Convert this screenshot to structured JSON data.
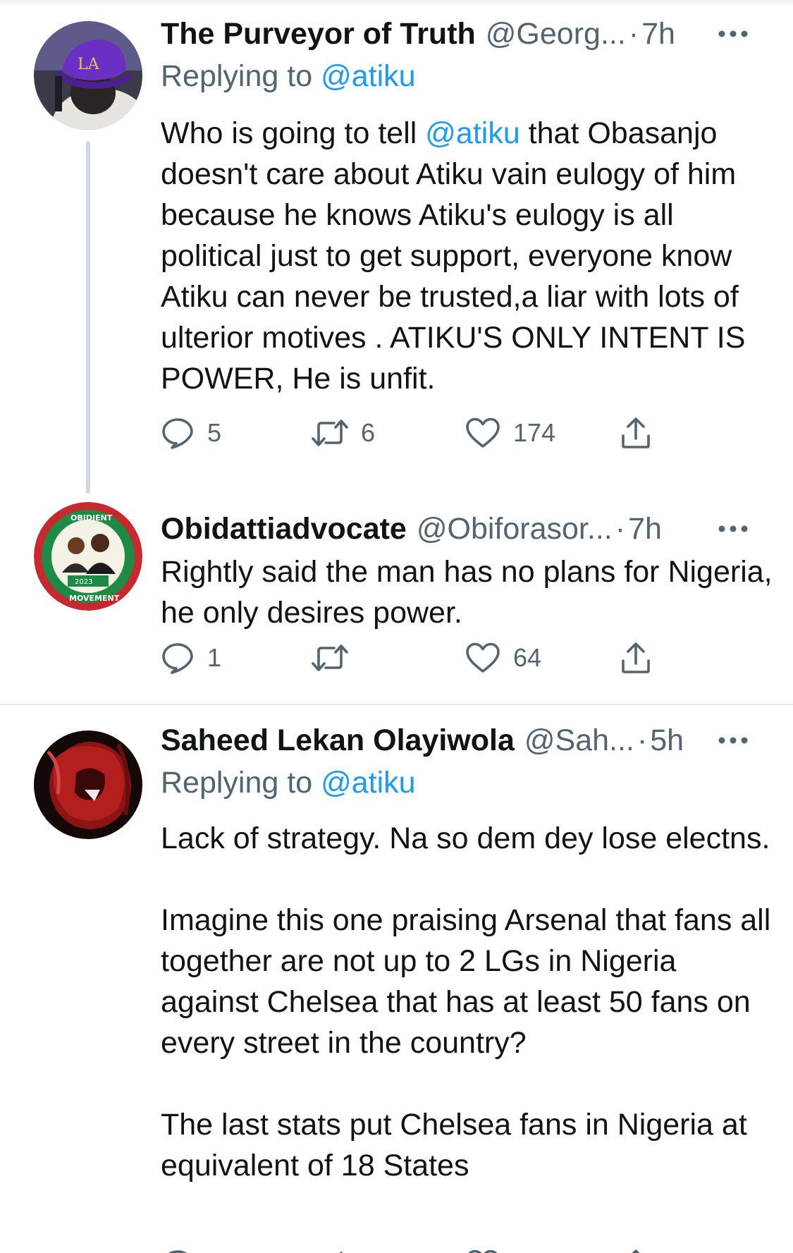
{
  "tweets": [
    {
      "name": "The Purveyor of Truth",
      "handle": "@Georg...",
      "separator": "·",
      "time": "7h",
      "replying_prefix": "Replying to",
      "replying_to": "@atiku",
      "text_before": "Who is going to tell ",
      "text_mention": "@atiku",
      "text_after": " that Obasanjo doesn't care about Atiku vain eulogy of him because he knows Atiku's eulogy is all political just to get support, everyone know Atiku can never be trusted,a liar with lots of ulterior motives . ATIKU'S ONLY INTENT IS POWER, He is unfit.",
      "replies": "5",
      "retweets": "6",
      "likes": "174"
    },
    {
      "name": "Obidattiadvocate",
      "handle": "@Obiforasor...",
      "separator": "·",
      "time": "7h",
      "text": "Rightly said the man has no plans for Nigeria, he only desires power.",
      "replies": "1",
      "retweets": "",
      "likes": "64"
    },
    {
      "name": "Saheed Lekan Olayiwola",
      "handle": "@Sah...",
      "separator": "·",
      "time": "5h",
      "replying_prefix": "Replying to",
      "replying_to": "@atiku",
      "paragraphs": [
        "Lack of strategy. Na so dem dey lose electns.",
        "Imagine this one praising Arsenal that fans all together are not up to 2 LGs in Nigeria against Chelsea that has at least 50 fans on every street in the country?",
        "The last stats put Chelsea fans in Nigeria at equivalent of 18 States"
      ]
    }
  ],
  "icons": {
    "reply": "speech-bubble-icon",
    "retweet": "retweet-arrows-icon",
    "like": "heart-icon",
    "share": "share-upload-icon",
    "more": "three-dots-icon"
  },
  "colors": {
    "link": "#1d9bf0",
    "secondary_text": "#536471",
    "primary_text": "#0f1419",
    "thread_line": "#cfd9de",
    "divider": "#e6e9ec"
  }
}
